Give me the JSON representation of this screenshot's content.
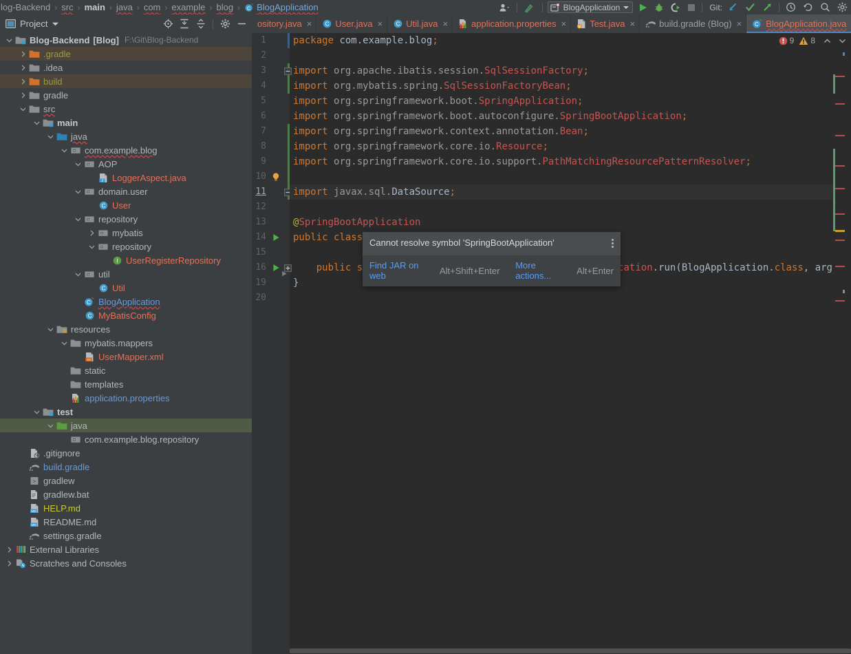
{
  "window": {
    "theme_bg": "#3c3f41",
    "editor_bg": "#2b2b2b",
    "accent": "#4a88c7"
  },
  "breadcrumbs": [
    {
      "label": "log-Backend",
      "style": "plain"
    },
    {
      "label": "src",
      "style": "wavy"
    },
    {
      "label": "main",
      "style": "bold"
    },
    {
      "label": "java",
      "style": "wavy"
    },
    {
      "label": "com",
      "style": "wavy"
    },
    {
      "label": "example",
      "style": "wavy"
    },
    {
      "label": "blog",
      "style": "wavy"
    },
    {
      "label": "BlogApplication",
      "style": "class"
    }
  ],
  "toolbar": {
    "user_icon": "user-avatar-icon",
    "build_icon": "build-hammer-icon",
    "run_config": "BlogApplication",
    "run_config_icon": "spring-boot-config-icon",
    "run_label": "run-icon",
    "debug_label": "debug-icon",
    "coverage_label": "run-with-coverage-icon",
    "stop_label": "stop-icon",
    "git_label": "Git:",
    "git_update": "update-project-icon",
    "git_commit": "commit-icon",
    "git_push": "push-icon",
    "history": "history-icon",
    "revert": "revert-icon",
    "search": "search-everywhere-icon",
    "settings": "settings-gear-icon"
  },
  "project_panel": {
    "title": "Project",
    "icons": [
      {
        "name": "select-opened-file-icon"
      },
      {
        "name": "expand-all-icon"
      },
      {
        "name": "collapse-all-icon"
      },
      {
        "name": "settings-gear-icon"
      },
      {
        "name": "hide-panel-icon"
      }
    ],
    "tree": [
      {
        "indent": 0,
        "arrow": "down",
        "icon": "module-folder",
        "label": "Blog-Backend",
        "bracket": "[Blog]",
        "path": "F:\\Git\\Blog-Backend",
        "color": "bold"
      },
      {
        "indent": 1,
        "arrow": "right",
        "icon": "folder-excluded",
        "label": ".gradle",
        "color": "olive",
        "row": "sel-brown"
      },
      {
        "indent": 1,
        "arrow": "right",
        "icon": "folder",
        "label": ".idea",
        "color": "plain"
      },
      {
        "indent": 1,
        "arrow": "right",
        "icon": "folder-excluded",
        "label": "build",
        "color": "olive",
        "row": "sel-brown"
      },
      {
        "indent": 1,
        "arrow": "right",
        "icon": "folder",
        "label": "gradle",
        "color": "plain"
      },
      {
        "indent": 1,
        "arrow": "down",
        "icon": "folder",
        "label": "src",
        "color": "plain",
        "wavy": true
      },
      {
        "indent": 2,
        "arrow": "down",
        "icon": "module-folder",
        "label": "main",
        "color": "bold"
      },
      {
        "indent": 3,
        "arrow": "down",
        "icon": "source-root-folder",
        "label": "java",
        "color": "plain",
        "wavy": true
      },
      {
        "indent": 4,
        "arrow": "down",
        "icon": "package",
        "label": "com.example.blog",
        "color": "plain",
        "wavy": true
      },
      {
        "indent": 5,
        "arrow": "down",
        "icon": "package",
        "label": "AOP",
        "color": "plain"
      },
      {
        "indent": 6,
        "arrow": "none",
        "icon": "java-file",
        "label": "LoggerAspect.java",
        "color": "file-red"
      },
      {
        "indent": 5,
        "arrow": "down",
        "icon": "package",
        "label": "domain.user",
        "color": "plain"
      },
      {
        "indent": 6,
        "arrow": "none",
        "icon": "class",
        "label": "User",
        "color": "file-red"
      },
      {
        "indent": 5,
        "arrow": "down",
        "icon": "package",
        "label": "repository",
        "color": "plain"
      },
      {
        "indent": 6,
        "arrow": "right",
        "icon": "package",
        "label": "mybatis",
        "color": "plain"
      },
      {
        "indent": 6,
        "arrow": "down",
        "icon": "package",
        "label": "repository",
        "color": "plain"
      },
      {
        "indent": 7,
        "arrow": "none",
        "icon": "interface",
        "label": "UserRegisterRepository",
        "color": "file-red"
      },
      {
        "indent": 5,
        "arrow": "down",
        "icon": "package",
        "label": "util",
        "color": "plain"
      },
      {
        "indent": 6,
        "arrow": "none",
        "icon": "class",
        "label": "Util",
        "color": "file-red"
      },
      {
        "indent": 5,
        "arrow": "none",
        "icon": "spring-class",
        "label": "BlogApplication",
        "color": "blue",
        "wavy": true
      },
      {
        "indent": 5,
        "arrow": "none",
        "icon": "class",
        "label": "MyBatisConfig",
        "color": "file-red"
      },
      {
        "indent": 3,
        "arrow": "down",
        "icon": "resource-root-folder",
        "label": "resources",
        "color": "plain"
      },
      {
        "indent": 4,
        "arrow": "down",
        "icon": "folder",
        "label": "mybatis.mappers",
        "color": "plain"
      },
      {
        "indent": 5,
        "arrow": "none",
        "icon": "xml-file",
        "label": "UserMapper.xml",
        "color": "file-red"
      },
      {
        "indent": 4,
        "arrow": "none",
        "icon": "folder",
        "label": "static",
        "color": "plain"
      },
      {
        "indent": 4,
        "arrow": "none",
        "icon": "folder",
        "label": "templates",
        "color": "plain"
      },
      {
        "indent": 4,
        "arrow": "none",
        "icon": "properties-file",
        "label": "application.properties",
        "color": "blue"
      },
      {
        "indent": 2,
        "arrow": "down",
        "icon": "test-module-folder",
        "label": "test",
        "color": "bold"
      },
      {
        "indent": 3,
        "arrow": "down",
        "icon": "test-source-root-folder",
        "label": "java",
        "color": "plain",
        "row": "sel-green"
      },
      {
        "indent": 4,
        "arrow": "none",
        "icon": "package",
        "label": "com.example.blog.repository",
        "color": "plain"
      },
      {
        "indent": 1,
        "arrow": "none",
        "icon": "gitignore-file",
        "label": ".gitignore",
        "color": "plain"
      },
      {
        "indent": 1,
        "arrow": "none",
        "icon": "gradle-file",
        "label": "build.gradle",
        "color": "blue"
      },
      {
        "indent": 1,
        "arrow": "none",
        "icon": "shell-script-file",
        "label": "gradlew",
        "color": "plain"
      },
      {
        "indent": 1,
        "arrow": "none",
        "icon": "bat-file",
        "label": "gradlew.bat",
        "color": "plain"
      },
      {
        "indent": 1,
        "arrow": "none",
        "icon": "markdown-file",
        "label": "HELP.md",
        "color": "yellow"
      },
      {
        "indent": 1,
        "arrow": "none",
        "icon": "markdown-file",
        "label": "README.md",
        "color": "plain"
      },
      {
        "indent": 1,
        "arrow": "none",
        "icon": "gradle-file",
        "label": "settings.gradle",
        "color": "plain"
      },
      {
        "indent": 0,
        "arrow": "right",
        "icon": "external-libraries",
        "label": "External Libraries",
        "color": "plain"
      },
      {
        "indent": 0,
        "arrow": "right",
        "icon": "scratches",
        "label": "Scratches and Consoles",
        "color": "plain"
      }
    ]
  },
  "editor_tabs": [
    {
      "label": "ository.java",
      "icon": "interface",
      "active": false,
      "close": true
    },
    {
      "label": "User.java",
      "icon": "class",
      "active": false,
      "close": true
    },
    {
      "label": "Util.java",
      "icon": "class",
      "active": false,
      "close": true
    },
    {
      "label": "application.properties",
      "icon": "properties-file",
      "active": false,
      "close": true
    },
    {
      "label": "Test.java",
      "icon": "java-test-file",
      "active": false,
      "close": true
    },
    {
      "label": "build.gradle (Blog)",
      "icon": "gradle-file",
      "active": false,
      "close": true,
      "gray": true
    },
    {
      "label": "BlogApplication.java",
      "icon": "spring-class",
      "active": true,
      "close": true
    }
  ],
  "editor": {
    "inspections": {
      "errors": "9",
      "warnings": "8",
      "error_icon": "error-icon",
      "warning_icon": "warning-icon",
      "up_icon": "previous-problem-icon",
      "down_icon": "next-problem-icon"
    },
    "current_line": 11,
    "lines": [
      {
        "n": "1",
        "text": "package com.example.blog;"
      },
      {
        "n": "2",
        "text": ""
      },
      {
        "n": "3",
        "text": "import org.apache.ibatis.session.SqlSessionFactory;"
      },
      {
        "n": "4",
        "text": "import org.mybatis.spring.SqlSessionFactoryBean;"
      },
      {
        "n": "5",
        "text": "import org.springframework.boot.SpringApplication;"
      },
      {
        "n": "6",
        "text": "import org.springframework.boot.autoconfigure.SpringBootApplication;"
      },
      {
        "n": "7",
        "text": "import org.springframework.context.annotation.Bean;"
      },
      {
        "n": "8",
        "text": "import org.springframework.core.io.Resource;"
      },
      {
        "n": "9",
        "text": "import org.springframework.core.io.support.PathMatchingResourcePatternResolver;"
      },
      {
        "n": "10",
        "text": ""
      },
      {
        "n": "11",
        "text": "import javax.sql.DataSource;"
      },
      {
        "n": "12",
        "text": ""
      },
      {
        "n": "13",
        "text": "@SpringBootApplication"
      },
      {
        "n": "14",
        "text": "public class BlogApplication {"
      },
      {
        "n": "15",
        "text": ""
      },
      {
        "n": "16",
        "text": "    public static void main(String[] args) { SpringApplication.run(BlogApplication.class, args); }"
      },
      {
        "n": "19",
        "text": "}"
      },
      {
        "n": "20",
        "text": ""
      }
    ],
    "gutter_icons": [
      {
        "line": "10",
        "icon": "intention-bulb-icon"
      },
      {
        "line": "14",
        "icon": "run-gutter-icon"
      },
      {
        "line": "16",
        "icon": "run-gutter-icon"
      }
    ]
  },
  "popup": {
    "message": "Cannot resolve symbol 'SpringBootApplication'",
    "kebab_icon": "more-options-icon",
    "actions": [
      {
        "label": "Find JAR on web",
        "shortcut": "Alt+Shift+Enter"
      },
      {
        "label": "More actions...",
        "shortcut": "Alt+Enter"
      }
    ]
  }
}
